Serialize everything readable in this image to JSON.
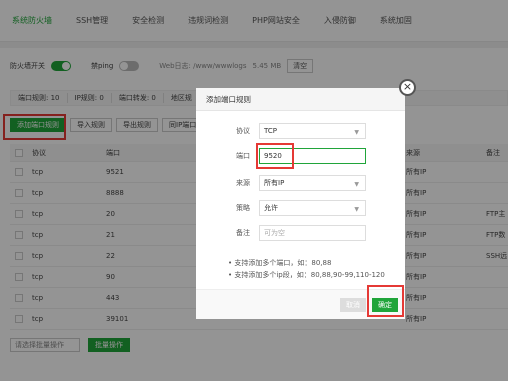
{
  "topnav": {
    "tabs": [
      "系统防火墙",
      "SSH管理",
      "安全检测",
      "违规词检测",
      "PHP网站安全",
      "入侵防御",
      "系统加固"
    ]
  },
  "options": {
    "firewall_label": "防火墙开关",
    "ping_label": "禁ping",
    "weblog_label": "Web日志: /www/wwwlogs",
    "weblog_size": "5.45 MB",
    "clear_label": "清空"
  },
  "stats": [
    "端口规则: 10",
    "IP规则: 0",
    "端口转发: 0",
    "地区规"
  ],
  "buttons": {
    "add_port_rule": "添加端口规则",
    "import_rules": "导入规则",
    "export_rules": "导出规则",
    "batch": "同IP端口规则"
  },
  "table": {
    "headers": [
      "协议",
      "端口",
      "来源",
      "备注"
    ],
    "rows": [
      {
        "proto": "tcp",
        "port": "9521",
        "source": "所有IP",
        "note": ""
      },
      {
        "proto": "tcp",
        "port": "8888",
        "source": "所有IP",
        "note": ""
      },
      {
        "proto": "tcp",
        "port": "20",
        "source": "所有IP",
        "note": "FTP主"
      },
      {
        "proto": "tcp",
        "port": "21",
        "source": "所有IP",
        "note": "FTP数"
      },
      {
        "proto": "tcp",
        "port": "22",
        "source": "所有IP",
        "note": "SSH远"
      },
      {
        "proto": "tcp",
        "port": "90",
        "source": "所有IP",
        "note": ""
      },
      {
        "proto": "tcp",
        "port": "443",
        "source": "所有IP",
        "note": ""
      },
      {
        "proto": "tcp",
        "port": "39101",
        "source": "所有IP",
        "note": ""
      }
    ]
  },
  "footer": {
    "select_placeholder": "请选择批量操作",
    "batch_button": "批量操作"
  },
  "modal": {
    "title": "添加端口规则",
    "close_symbol": "×",
    "protocol_label": "协议",
    "protocol_value": "TCP",
    "port_label": "端口",
    "port_value": "9520",
    "source_label": "来源",
    "source_value": "所有IP",
    "strategy_label": "策略",
    "strategy_value": "允许",
    "remark_label": "备注",
    "remark_placeholder": "可为空",
    "note1": "支持添加多个端口，如：80,88",
    "note2": "支持添加多个ip段，如：80,88,90-99,110-120",
    "cancel": "取消",
    "confirm": "确定"
  },
  "colors": {
    "accent": "#20a53a",
    "highlight": "#e53935"
  }
}
